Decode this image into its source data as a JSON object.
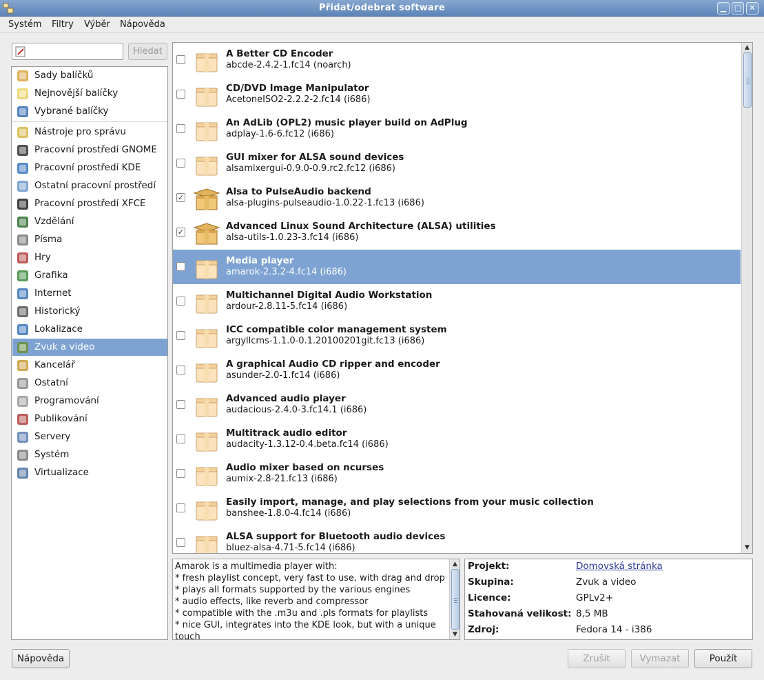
{
  "window": {
    "title": "Přidat/odebrat software",
    "minimize": "▁",
    "maximize": "□",
    "close": "✕"
  },
  "menubar": [
    "Systém",
    "Filtry",
    "Výběr",
    "Nápověda"
  ],
  "search": {
    "value": "",
    "button": "Hledat"
  },
  "groups": [
    {
      "label": "Sady balíčků",
      "icon": "package-collection-icon"
    },
    {
      "label": "Nejnovější balíčky",
      "icon": "lightbulb-icon"
    },
    {
      "label": "Vybrané balíčky",
      "icon": "magnifier-icon"
    },
    {
      "label": "Nástroje pro správu",
      "icon": "admin-tools-icon"
    },
    {
      "label": "Pracovní prostředí GNOME",
      "icon": "gnome-foot-icon"
    },
    {
      "label": "Pracovní prostředí KDE",
      "icon": "kde-icon"
    },
    {
      "label": "Ostatní pracovní prostředí",
      "icon": "desktop-icon"
    },
    {
      "label": "Pracovní prostředí XFCE",
      "icon": "xfce-mouse-icon"
    },
    {
      "label": "Vzdělání",
      "icon": "education-icon"
    },
    {
      "label": "Písma",
      "icon": "fonts-icon"
    },
    {
      "label": "Hry",
      "icon": "joystick-icon"
    },
    {
      "label": "Grafika",
      "icon": "graphics-icon"
    },
    {
      "label": "Internet",
      "icon": "globe-icon"
    },
    {
      "label": "Historický",
      "icon": "floppy-icon"
    },
    {
      "label": "Lokalizace",
      "icon": "flag-icon"
    },
    {
      "label": "Zvuk a video",
      "icon": "multimedia-icon",
      "selected": true
    },
    {
      "label": "Kancelář",
      "icon": "office-icon"
    },
    {
      "label": "Ostatní",
      "icon": "other-icon"
    },
    {
      "label": "Programování",
      "icon": "programming-icon"
    },
    {
      "label": "Publikování",
      "icon": "publishing-icon"
    },
    {
      "label": "Servery",
      "icon": "server-icon"
    },
    {
      "label": "Systém",
      "icon": "system-gear-icon"
    },
    {
      "label": "Virtualizace",
      "icon": "monitor-icon"
    }
  ],
  "packages": [
    {
      "name": "A Better CD Encoder",
      "version": "abcde-2.4.2-1.fc14 (noarch)",
      "checked": false,
      "installed": false
    },
    {
      "name": "CD/DVD Image Manipulator",
      "version": "AcetoneISO2-2.2.2-2.fc14 (i686)",
      "checked": false,
      "installed": false
    },
    {
      "name": "An AdLib (OPL2) music player build on AdPlug",
      "version": "adplay-1.6-6.fc12 (i686)",
      "checked": false,
      "installed": false
    },
    {
      "name": "GUI mixer for ALSA sound devices",
      "version": "alsamixergui-0.9.0-0.9.rc2.fc12 (i686)",
      "checked": false,
      "installed": false
    },
    {
      "name": "Alsa to PulseAudio backend",
      "version": "alsa-plugins-pulseaudio-1.0.22-1.fc13 (i686)",
      "checked": true,
      "installed": true
    },
    {
      "name": "Advanced Linux Sound Architecture (ALSA) utilities",
      "version": "alsa-utils-1.0.23-3.fc14 (i686)",
      "checked": true,
      "installed": true
    },
    {
      "name": "Media player",
      "version": "amarok-2.3.2-4.fc14 (i686)",
      "checked": false,
      "installed": false,
      "selected": true
    },
    {
      "name": "Multichannel Digital Audio Workstation",
      "version": "ardour-2.8.11-5.fc14 (i686)",
      "checked": false,
      "installed": false
    },
    {
      "name": "ICC compatible color management system",
      "version": "argyllcms-1.1.0-0.1.20100201git.fc13 (i686)",
      "checked": false,
      "installed": false
    },
    {
      "name": "A graphical Audio CD ripper and encoder",
      "version": "asunder-2.0-1.fc14 (i686)",
      "checked": false,
      "installed": false
    },
    {
      "name": "Advanced audio player",
      "version": "audacious-2.4.0-3.fc14.1 (i686)",
      "checked": false,
      "installed": false
    },
    {
      "name": "Multitrack audio editor",
      "version": "audacity-1.3.12-0.4.beta.fc14 (i686)",
      "checked": false,
      "installed": false
    },
    {
      "name": "Audio mixer based on ncurses",
      "version": "aumix-2.8-21.fc13 (i686)",
      "checked": false,
      "installed": false
    },
    {
      "name": "Easily import, manage, and play selections from your music collection",
      "version": "banshee-1.8.0-4.fc14 (i686)",
      "checked": false,
      "installed": false
    },
    {
      "name": "ALSA support for Bluetooth audio devices",
      "version": "bluez-alsa-4.71-5.fc14 (i686)",
      "checked": false,
      "installed": false
    }
  ],
  "description": "Amarok is a multimedia player with:\n* fresh playlist concept, very fast to use, with drag and drop\n* plays all formats supported by the various engines\n* audio effects, like reverb and compressor\n* compatible with the .m3u and .pls formats for playlists\n* nice GUI, integrates into the KDE look, but with a unique touch",
  "details": [
    {
      "label": "Projekt:",
      "value": "Domovská stránka",
      "link": true
    },
    {
      "label": "Skupina:",
      "value": "Zvuk a video"
    },
    {
      "label": "Licence:",
      "value": "GPLv2+"
    },
    {
      "label": "Stahovaná velikost:",
      "value": "8,5 MB"
    },
    {
      "label": "Zdroj:",
      "value": "Fedora 14 - i386"
    }
  ],
  "buttons": {
    "help": "Nápověda",
    "cancel": "Zrušit",
    "clear": "Vymazat",
    "apply": "Použít"
  },
  "colors": {
    "selection": "#7ea3d2",
    "titlebar": "#6d91c3"
  }
}
